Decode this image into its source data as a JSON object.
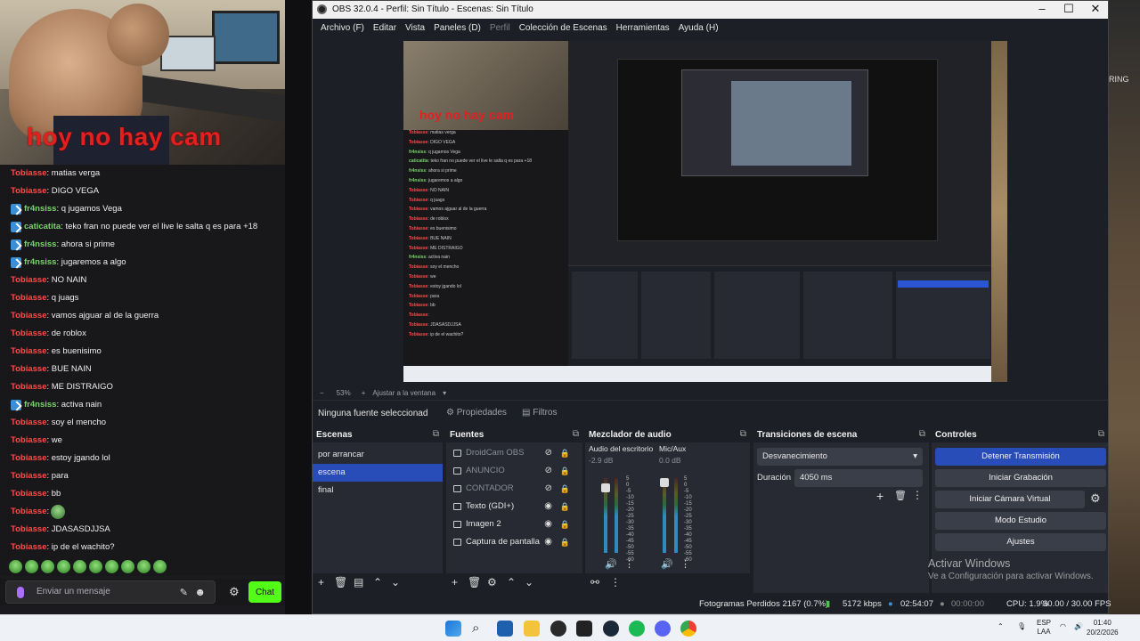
{
  "stream": {
    "overlay_text": "hoy no hay cam",
    "chat_messages": [
      {
        "user": "Tobiasse",
        "text": ": matias verga",
        "color": "#ff4a4a",
        "badge": false,
        "emote": false
      },
      {
        "user": "Tobiasse",
        "text": ": DIGO VEGA",
        "color": "#ff4a4a",
        "badge": false,
        "emote": false
      },
      {
        "user": "fr4nsiss",
        "text": ": q jugamos Vega",
        "color": "#7bd36b",
        "badge": true,
        "emote": false
      },
      {
        "user": "caticatita",
        "text": ": teko fran no puede ver el live le salta q es para +18",
        "color": "#7bd36b",
        "badge": true,
        "emote": false
      },
      {
        "user": "fr4nsiss",
        "text": ": ahora si prime",
        "color": "#7bd36b",
        "badge": true,
        "emote": false
      },
      {
        "user": "fr4nsiss",
        "text": ": jugaremos a algo",
        "color": "#7bd36b",
        "badge": true,
        "emote": false
      },
      {
        "user": "Tobiasse",
        "text": ": NO NAIN",
        "color": "#ff4a4a",
        "badge": false,
        "emote": false
      },
      {
        "user": "Tobiasse",
        "text": ": q juags",
        "color": "#ff4a4a",
        "badge": false,
        "emote": false
      },
      {
        "user": "Tobiasse",
        "text": ": vamos ajguar al de la guerra",
        "color": "#ff4a4a",
        "badge": false,
        "emote": false
      },
      {
        "user": "Tobiasse",
        "text": ": de roblox",
        "color": "#ff4a4a",
        "badge": false,
        "emote": false
      },
      {
        "user": "Tobiasse",
        "text": ": es buenisimo",
        "color": "#ff4a4a",
        "badge": false,
        "emote": false
      },
      {
        "user": "Tobiasse",
        "text": ": BUE NAIN",
        "color": "#ff4a4a",
        "badge": false,
        "emote": false
      },
      {
        "user": "Tobiasse",
        "text": ": ME DISTRAIGO",
        "color": "#ff4a4a",
        "badge": false,
        "emote": false
      },
      {
        "user": "fr4nsiss",
        "text": ": activa nain",
        "color": "#7bd36b",
        "badge": true,
        "emote": false
      },
      {
        "user": "Tobiasse",
        "text": ": soy el mencho",
        "color": "#ff4a4a",
        "badge": false,
        "emote": false
      },
      {
        "user": "Tobiasse",
        "text": ": we",
        "color": "#ff4a4a",
        "badge": false,
        "emote": false
      },
      {
        "user": "Tobiasse",
        "text": ": estoy jgando lol",
        "color": "#ff4a4a",
        "badge": false,
        "emote": false
      },
      {
        "user": "Tobiasse",
        "text": ": para",
        "color": "#ff4a4a",
        "badge": false,
        "emote": false
      },
      {
        "user": "Tobiasse",
        "text": ": bb",
        "color": "#ff4a4a",
        "badge": false,
        "emote": false
      },
      {
        "user": "Tobiasse",
        "text": ":",
        "color": "#ff4a4a",
        "badge": false,
        "emote": true
      },
      {
        "user": "Tobiasse",
        "text": ": JDASASDJJSA",
        "color": "#ff4a4a",
        "badge": false,
        "emote": false
      },
      {
        "user": "Tobiasse",
        "text": ": ip de el wachito?",
        "color": "#ff4a4a",
        "badge": false,
        "emote": false
      }
    ],
    "chat_placeholder": "Enviar un mensaje",
    "chat_button": "Chat",
    "chat_accent": "#53fc18"
  },
  "background_right_text": [
    "RING"
  ],
  "obs": {
    "title": "OBS 32.0.4 - Perfil: Sin Título - Escenas: Sin Título",
    "menu": [
      "Archivo (F)",
      "Editar",
      "Vista",
      "Paneles (D)",
      "Perfil",
      "Colección de Escenas",
      "Herramientas",
      "Ayuda (H)"
    ],
    "zoom_bar": {
      "minus": "−",
      "zoom": "53%",
      "plus": "+",
      "fit": "Ajustar a la ventana"
    },
    "source_bar": {
      "no_source": "Ninguna fuente seleccionad",
      "properties": "Propiedades",
      "filters": "Filtros"
    },
    "scenes": {
      "title": "Escenas",
      "items": [
        "por arrancar",
        "escena",
        "final"
      ],
      "selected_index": 1
    },
    "sources": {
      "title": "Fuentes",
      "items": [
        {
          "name": "DroidCam OBS",
          "visible": false
        },
        {
          "name": "ANUNCIO",
          "visible": false
        },
        {
          "name": "CONTADOR",
          "visible": false
        },
        {
          "name": "Texto (GDI+)",
          "visible": true
        },
        {
          "name": "Imagen 2",
          "visible": true
        },
        {
          "name": "Captura de pantalla",
          "visible": true
        }
      ]
    },
    "mixer": {
      "title": "Mezclador de audio",
      "channels": [
        {
          "name": "Audio del escritorio",
          "db": "-2.9 dB",
          "level": 0.93
        },
        {
          "name": "Mic/Aux",
          "db": "0.0 dB",
          "level": 1.0
        }
      ],
      "scale": [
        "5",
        "0",
        "-5",
        "-10",
        "-15",
        "-20",
        "-25",
        "-30",
        "-35",
        "-40",
        "-45",
        "-50",
        "-55",
        "-60"
      ]
    },
    "transitions": {
      "title": "Transiciones de escena",
      "selected": "Desvanecimiento",
      "duration_label": "Duración",
      "duration_value": "4050 ms"
    },
    "controls": {
      "title": "Controles",
      "buttons": [
        "Detener Transmisión",
        "Iniciar Grabación",
        "Iniciar Cámara Virtual",
        "Modo Estudio",
        "Ajustes"
      ]
    },
    "status": {
      "dropped_frames": "Fotogramas Perdidos 2167 (0.7%)",
      "bitrate": "5172 kbps",
      "stream_time": "02:54:07",
      "rec_time": "00:00:00",
      "cpu": "CPU: 1.9%",
      "fps": "30.00 / 30.00 FPS"
    },
    "activate_windows": {
      "line1": "Activar Windows",
      "line2": "Ve a Configuración para activar Windows."
    }
  },
  "taskbar": {
    "lang": "ESP",
    "lang2": "LAA",
    "time": "01:40",
    "date": "20/2/2026"
  }
}
